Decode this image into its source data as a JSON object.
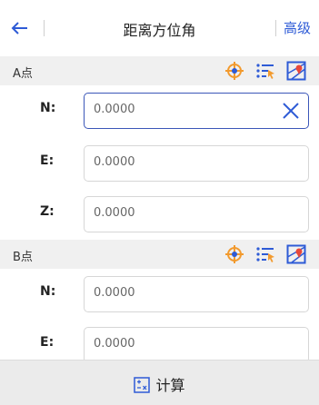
{
  "header": {
    "title": "距离方位角",
    "advanced": "高级"
  },
  "sections": [
    {
      "label": "A点"
    },
    {
      "label": "B点"
    }
  ],
  "pointA": [
    {
      "key": "N:",
      "value": "0.0000"
    },
    {
      "key": "E:",
      "value": "0.0000"
    },
    {
      "key": "Z:",
      "value": "0.0000"
    }
  ],
  "pointB": [
    {
      "key": "N:",
      "value": "0.0000"
    },
    {
      "key": "E:",
      "value": "0.0000"
    }
  ],
  "footer": {
    "calculate": "计算"
  },
  "colors": {
    "accent": "#2e5bd6",
    "icon_orange": "#f29a2e",
    "icon_blue": "#2e5bd6",
    "active_border": "#3b56b8"
  },
  "icons": [
    "back-arrow-icon",
    "locate-icon",
    "list-select-icon",
    "map-pick-icon",
    "clear-icon",
    "calculator-icon"
  ]
}
